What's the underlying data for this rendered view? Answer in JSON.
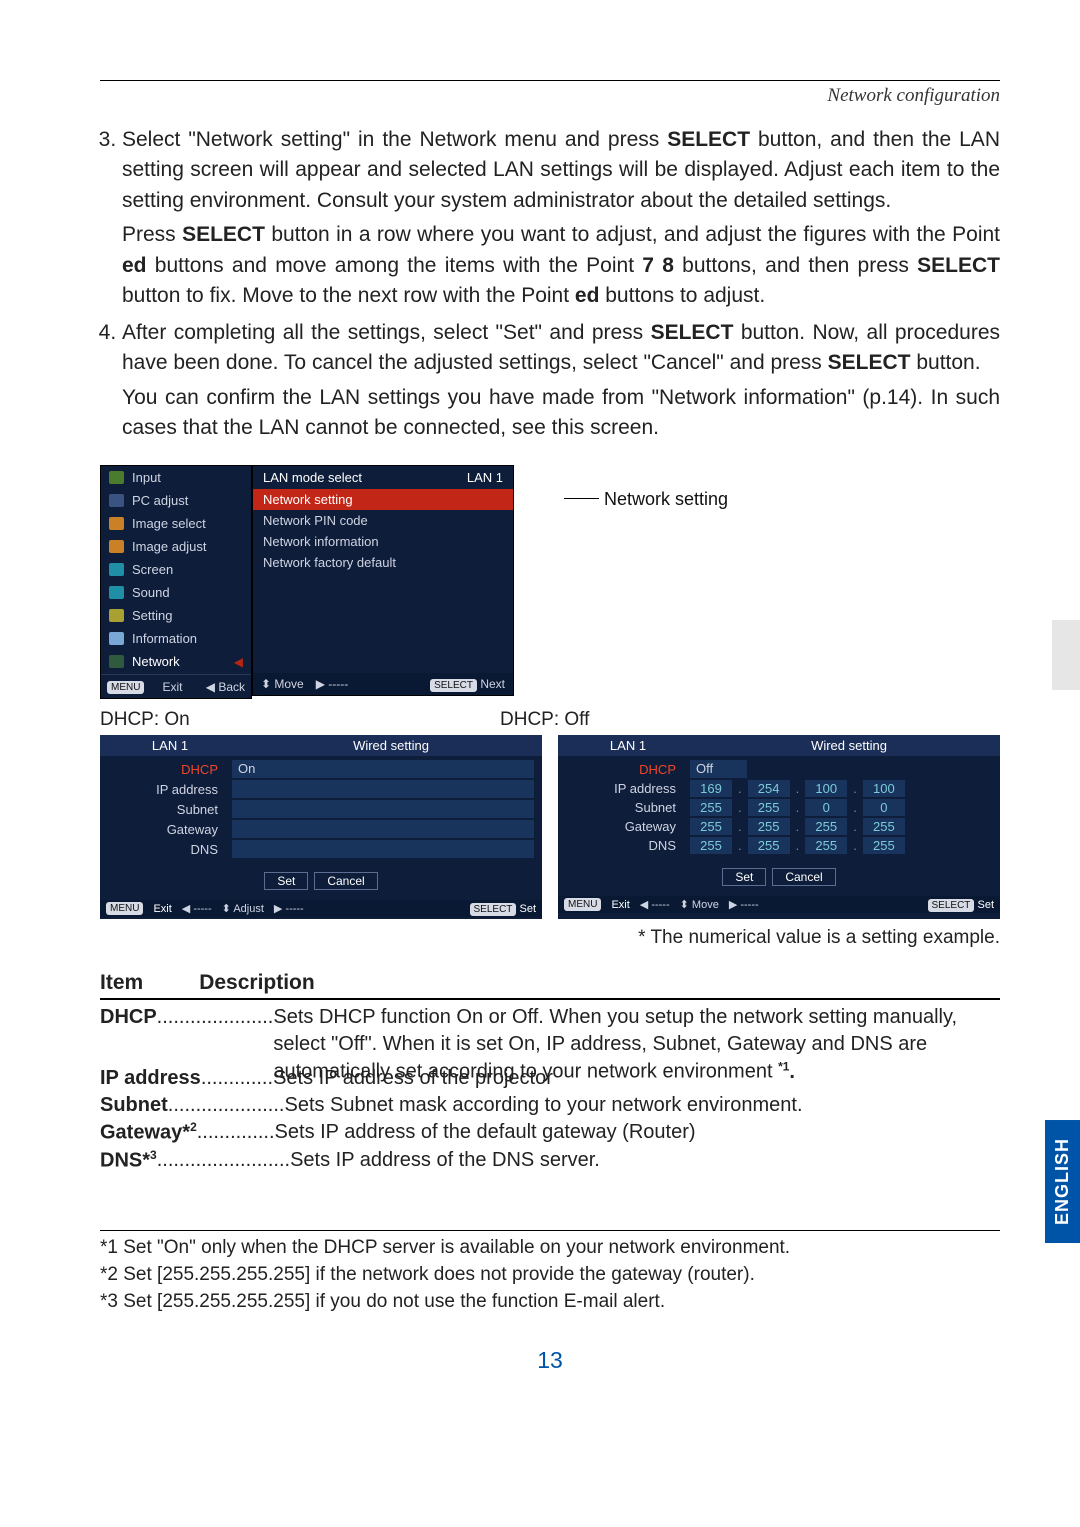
{
  "section_header": "Network configuration",
  "instructions": {
    "item3": {
      "number": "3.",
      "para1_pre": "Select \"Network setting\" in the Network menu and press ",
      "kw1": "SELECT",
      "para1_post": " button, and then the LAN setting screen will appear and selected LAN settings will be displayed. Adjust each item to the setting environment. Consult your system administrator about the detailed settings.",
      "para2_pre": "Press ",
      "kw2": "SELECT",
      "para2_mid1": " button in a row where you want to adjust, and adjust the figures with the Point ",
      "kw_ed1": "ed",
      "para2_mid2": " buttons and move among the items with the Point ",
      "kw_78": "7 8",
      "para2_mid3": " buttons, and then press ",
      "kw3": "SELECT",
      "para2_mid4": " button to fix. Move to the next row with the Point ",
      "kw_ed2": "ed",
      "para2_end": " buttons to adjust."
    },
    "item4": {
      "number": "4.",
      "para1_pre": "After completing all the settings, select \"Set\" and press ",
      "kw1": "SELECT",
      "para1_mid": " button. Now, all procedures have been done. To cancel the adjusted settings, select \"Cancel\" and press ",
      "kw2": "SELECT",
      "para1_end": " button.",
      "para2": "You can confirm the LAN settings you have made from \"Network information\" (p.14). In such cases  that the LAN cannot be connected, see this screen."
    }
  },
  "osd_left": {
    "items": [
      "Input",
      "PC adjust",
      "Image select",
      "Image adjust",
      "Screen",
      "Sound",
      "Setting",
      "Information",
      "Network"
    ],
    "exit_label": "Exit",
    "back_label": "Back",
    "menu_pill": "MENU"
  },
  "osd_right": {
    "top_left": "LAN mode select",
    "top_right": "LAN 1",
    "rows": [
      "Network setting",
      "Network PIN code",
      "Network information",
      "Network factory default"
    ],
    "foot_move": "Move",
    "foot_dash": "-----",
    "foot_next": "Next",
    "foot_select_pill": "SELECT"
  },
  "annotation_label": "Network setting",
  "dhcp_on_label": "DHCP: On",
  "dhcp_off_label": "DHCP: Off",
  "dhcp_panel": {
    "lan": "LAN 1",
    "wired": "Wired setting",
    "rows": {
      "dhcp": "DHCP",
      "ip": "IP address",
      "subnet": "Subnet",
      "gateway": "Gateway",
      "dns": "DNS"
    },
    "on_value": "On",
    "off_value": "Off",
    "ip_vals": [
      "169",
      "254",
      "100",
      "100"
    ],
    "subnet_vals": [
      "255",
      "255",
      "0",
      "0"
    ],
    "gateway_vals": [
      "255",
      "255",
      "255",
      "255"
    ],
    "dns_vals": [
      "255",
      "255",
      "255",
      "255"
    ],
    "set_btn": "Set",
    "cancel_btn": "Cancel",
    "foot_exit": "Exit",
    "foot_adjust": "Adjust",
    "foot_move": "Move",
    "foot_set": "Set",
    "menu_pill": "MENU",
    "select_pill": "SELECT",
    "dash": "-----"
  },
  "numeric_note": "* The numerical value is a setting example.",
  "table": {
    "head_item": "Item",
    "head_desc": "Description",
    "dhcp_name": "DHCP",
    "dhcp_desc1": "Sets DHCP function On or Off. When you setup the network setting manually, select \"Off\". When it is set On, IP address, Subnet, Gateway  and DNS are automatically set according to your network environment ",
    "dhcp_sup": "*1",
    "dhcp_end": ".",
    "ip_name": "IP address",
    "ip_desc": "Sets IP address of the projector",
    "subnet_name": "Subnet",
    "subnet_desc": "Sets Subnet mask according to your network environment.",
    "gw_name": "Gateway*",
    "gw_sup": "2",
    "gw_desc": "Sets IP address of the default gateway (Router)",
    "dns_name": "DNS*",
    "dns_sup": "3",
    "dns_desc": "Sets IP address of the DNS server."
  },
  "footnotes": {
    "f1": "*1 Set \"On\" only when the DHCP server is available on your network environment.",
    "f2": "*2 Set [255.255.255.255] if the network does not provide the gateway (router).",
    "f3": "*3 Set [255.255.255.255] if you do not use the function E-mail alert."
  },
  "page_number": "13",
  "side_tab": "ENGLISH"
}
